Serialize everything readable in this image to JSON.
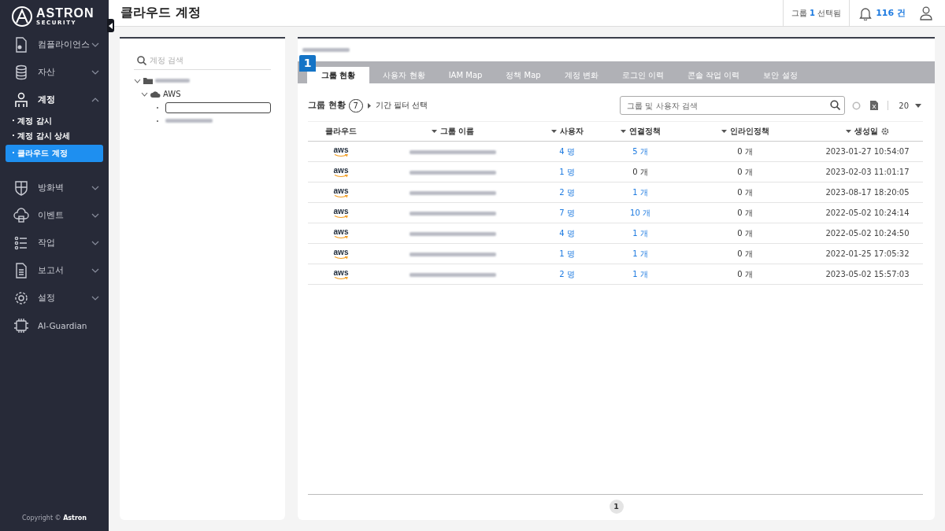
{
  "sidebar": {
    "logo": {
      "name": "ASTRON",
      "sub": "SECURITY"
    },
    "items": [
      {
        "kind": "group",
        "label": "컴플라이언스",
        "expanded": false
      },
      {
        "kind": "group",
        "label": "자산",
        "expanded": false
      },
      {
        "kind": "group",
        "label": "계정",
        "expanded": true,
        "children": [
          {
            "label": "· 계정 감시",
            "selected": false
          },
          {
            "label": "· 계정 감시 상세",
            "selected": false
          },
          {
            "label": "· 클라우드 계정",
            "selected": true
          }
        ]
      },
      {
        "kind": "group",
        "label": "방화벽",
        "expanded": false
      },
      {
        "kind": "group",
        "label": "이벤트",
        "expanded": false
      },
      {
        "kind": "group",
        "label": "작업",
        "expanded": false
      },
      {
        "kind": "group",
        "label": "보고서",
        "expanded": false
      },
      {
        "kind": "group",
        "label": "설정",
        "expanded": false
      },
      {
        "kind": "link",
        "label": "AI-Guardian"
      }
    ],
    "copyright": "Copyright © **Astron**"
  },
  "header": {
    "title": "클라우드 계정",
    "selection": "그룹 **1** 선택됨",
    "alerts": "116 건"
  },
  "tree": {
    "search": {
      "placeholder": "계정 검색"
    },
    "nodes": [
      {
        "kind": "folder",
        "redacted": true,
        "expanded": true,
        "children": [
          {
            "kind": "cloud",
            "label": "AWS",
            "expanded": true,
            "children": [
              {
                "kind": "leaf",
                "redacted": true,
                "selected": true
              },
              {
                "kind": "leaf",
                "redacted": true,
                "selected": false
              }
            ]
          }
        ]
      }
    ]
  },
  "panel": {
    "title_redacted": true,
    "badge": "1",
    "tabs": [
      {
        "label": "그룹 현황",
        "selected": true
      },
      {
        "label": "사용자 현황",
        "selected": false
      },
      {
        "label": "IAM Map",
        "selected": false
      },
      {
        "label": "정책 Map",
        "selected": false
      },
      {
        "label": "계정 변화",
        "selected": false
      },
      {
        "label": "로그인 이력",
        "selected": false
      },
      {
        "label": "콘솔 작업 이력",
        "selected": false
      },
      {
        "label": "보안 설정",
        "selected": false
      }
    ],
    "toolbar": {
      "title": "그룹 현황",
      "count": "7",
      "filter": "기간 필터 선택",
      "search": {
        "placeholder": "그룹 및 사용자 검색"
      },
      "page_size": "20"
    },
    "table": {
      "columns": [
        {
          "label": "클라우드",
          "sortable": false
        },
        {
          "label": "그룹 이름",
          "sortable": true
        },
        {
          "label": "사용자",
          "sortable": true
        },
        {
          "label": "연결정책",
          "sortable": true
        },
        {
          "label": "인라인정책",
          "sortable": true
        },
        {
          "label": "생성일",
          "sortable": true,
          "settings": true
        }
      ],
      "rows": [
        {
          "cloud": "aws",
          "name_redacted": true,
          "users": "4 명",
          "users_link": true,
          "policies": "5 개",
          "policies_link": true,
          "inline": "0 개",
          "created": "2023-01-27 10:54:07"
        },
        {
          "cloud": "aws",
          "name_redacted": true,
          "users": "1 명",
          "users_link": true,
          "policies": "0 개",
          "policies_link": false,
          "inline": "0 개",
          "created": "2023-02-03 11:01:17"
        },
        {
          "cloud": "aws",
          "name_redacted": true,
          "users": "2 명",
          "users_link": true,
          "policies": "1 개",
          "policies_link": true,
          "inline": "0 개",
          "created": "2023-08-17 18:20:05"
        },
        {
          "cloud": "aws",
          "name_redacted": true,
          "users": "7 명",
          "users_link": true,
          "policies": "10 개",
          "policies_link": true,
          "inline": "0 개",
          "created": "2022-05-02 10:24:14"
        },
        {
          "cloud": "aws",
          "name_redacted": true,
          "users": "4 명",
          "users_link": true,
          "policies": "1 개",
          "policies_link": true,
          "inline": "0 개",
          "created": "2022-05-02 10:24:50"
        },
        {
          "cloud": "aws",
          "name_redacted": true,
          "users": "1 명",
          "users_link": true,
          "policies": "1 개",
          "policies_link": true,
          "inline": "0 개",
          "created": "2022-01-25 17:05:32"
        },
        {
          "cloud": "aws",
          "name_redacted": true,
          "users": "2 명",
          "users_link": true,
          "policies": "1 개",
          "policies_link": true,
          "inline": "0 개",
          "created": "2023-05-02 15:57:03"
        }
      ]
    },
    "pagination": [
      {
        "label": "1",
        "selected": true
      }
    ]
  }
}
